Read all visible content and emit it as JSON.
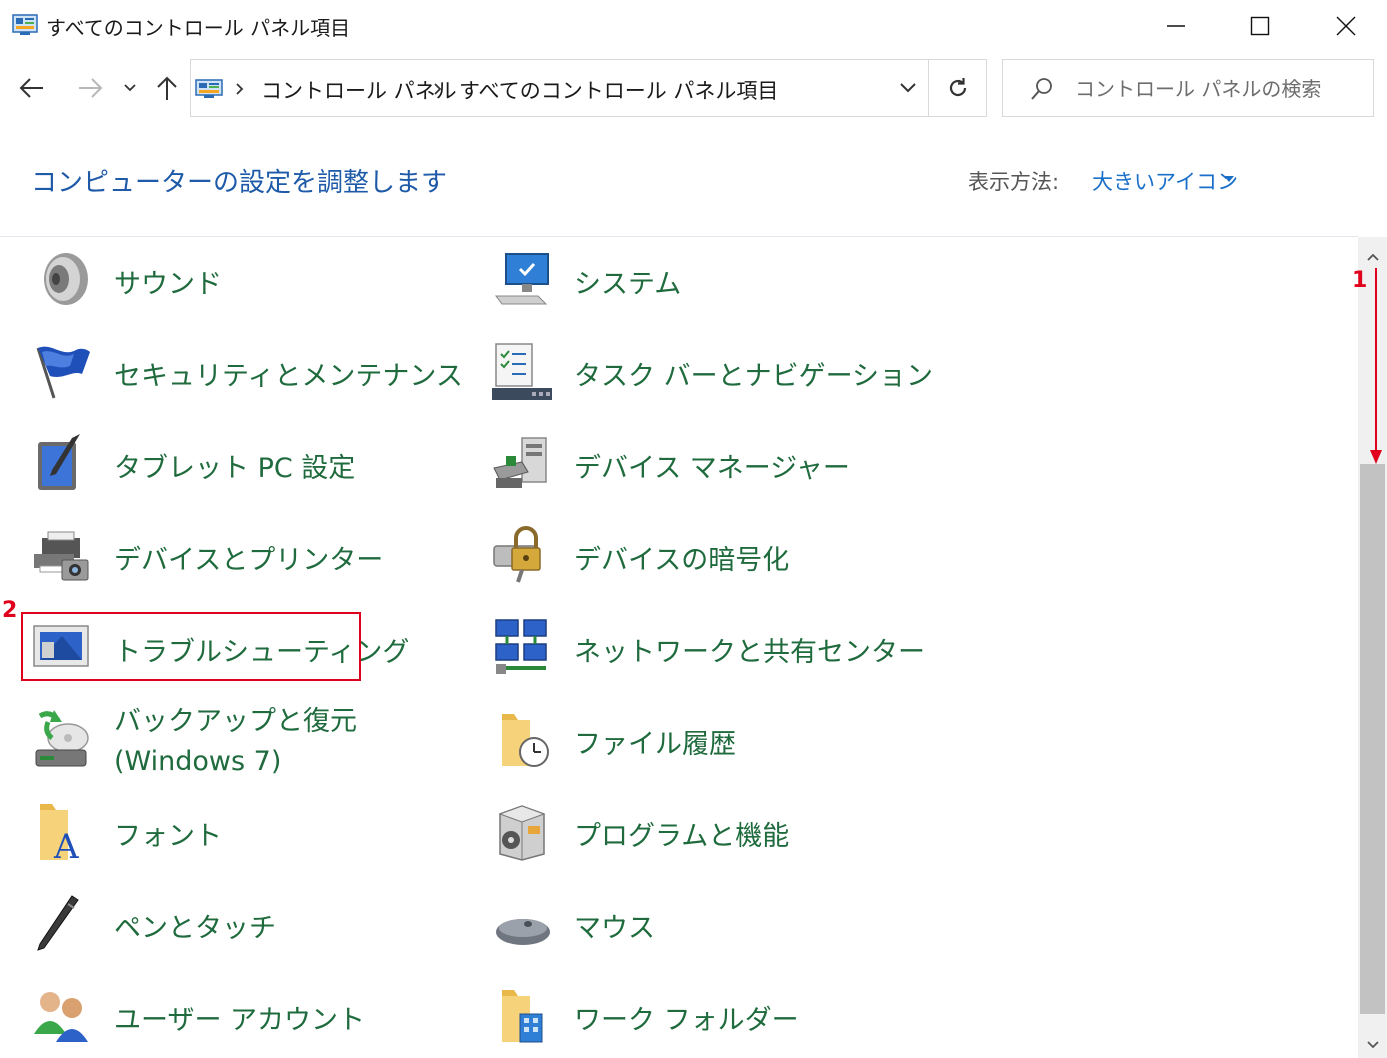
{
  "window": {
    "title": "すべてのコントロール パネル項目",
    "icon": "control-panel-icon"
  },
  "nav": {
    "breadcrumbs": [
      "コントロール パネル",
      "すべてのコントロール パネル項目"
    ],
    "search_placeholder": "コントロール パネルの検索"
  },
  "header": {
    "heading": "コンピューターの設定を調整します",
    "view_by_label": "表示方法:",
    "view_by_value": "大きいアイコン"
  },
  "items": [
    {
      "label": "サウンド",
      "icon": "speaker-icon"
    },
    {
      "label": "システム",
      "icon": "computer-monitor-icon"
    },
    {
      "label": "セキュリティとメンテナンス",
      "icon": "flag-icon"
    },
    {
      "label": "タスク バーとナビゲーション",
      "icon": "taskbar-checklist-icon"
    },
    {
      "label": "タブレット PC 設定",
      "icon": "tablet-pen-icon"
    },
    {
      "label": "デバイス マネージャー",
      "icon": "device-manager-icon"
    },
    {
      "label": "デバイスとプリンター",
      "icon": "printer-camera-icon"
    },
    {
      "label": "デバイスの暗号化",
      "icon": "padlock-drive-icon"
    },
    {
      "label": "トラブルシューティング",
      "icon": "troubleshoot-monitor-icon"
    },
    {
      "label": "ネットワークと共有センター",
      "icon": "network-icon"
    },
    {
      "label": "バックアップと復元\n(Windows 7)",
      "icon": "backup-drive-icon"
    },
    {
      "label": "ファイル履歴",
      "icon": "folder-clock-icon"
    },
    {
      "label": "フォント",
      "icon": "font-folder-icon"
    },
    {
      "label": "プログラムと機能",
      "icon": "programs-box-icon"
    },
    {
      "label": "ペンとタッチ",
      "icon": "pen-icon"
    },
    {
      "label": "マウス",
      "icon": "mouse-icon"
    },
    {
      "label": "ユーザー アカウント",
      "icon": "users-icon"
    },
    {
      "label": "ワーク フォルダー",
      "icon": "work-folder-icon"
    }
  ],
  "annotations": {
    "step1": "1",
    "step2": "2",
    "accent_color": "#e0001b"
  }
}
